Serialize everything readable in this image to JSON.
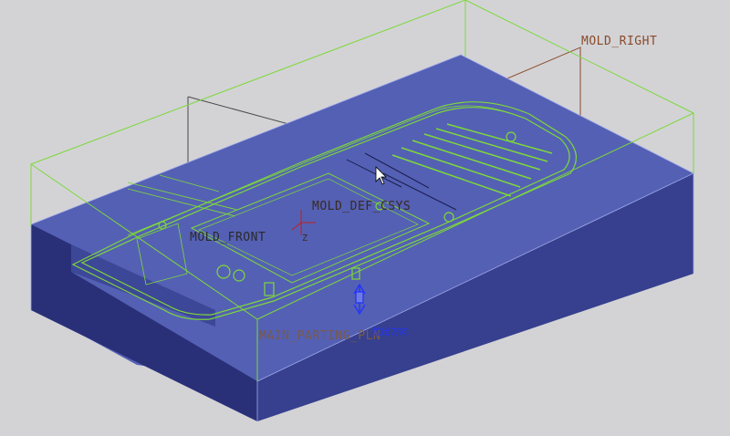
{
  "viewport": {
    "background": "#d3d3d6",
    "colors": {
      "block_top": "#5460b4",
      "block_front": "#2a3078",
      "block_right": "#36408e",
      "edge_green": "#7dd83a",
      "datum_brown": "#8a4a2a",
      "datum_gray": "#4a4a4a",
      "csys_red": "#c02020",
      "pull_blue": "#2233ff"
    }
  },
  "datums": {
    "mold_right": "MOLD_RIGHT",
    "mold_def_csys": "MOLD_DEF_CSYS",
    "mold_front": "MOLD_FRONT",
    "main_parting_pln": "MAIN_PARTING_PLN"
  },
  "pull_direction": {
    "label": "拉出方向",
    "icon": "arrow-icon"
  },
  "csys": {
    "z_label": "Z"
  },
  "cursor": {
    "icon": "mouse-pointer-icon"
  }
}
